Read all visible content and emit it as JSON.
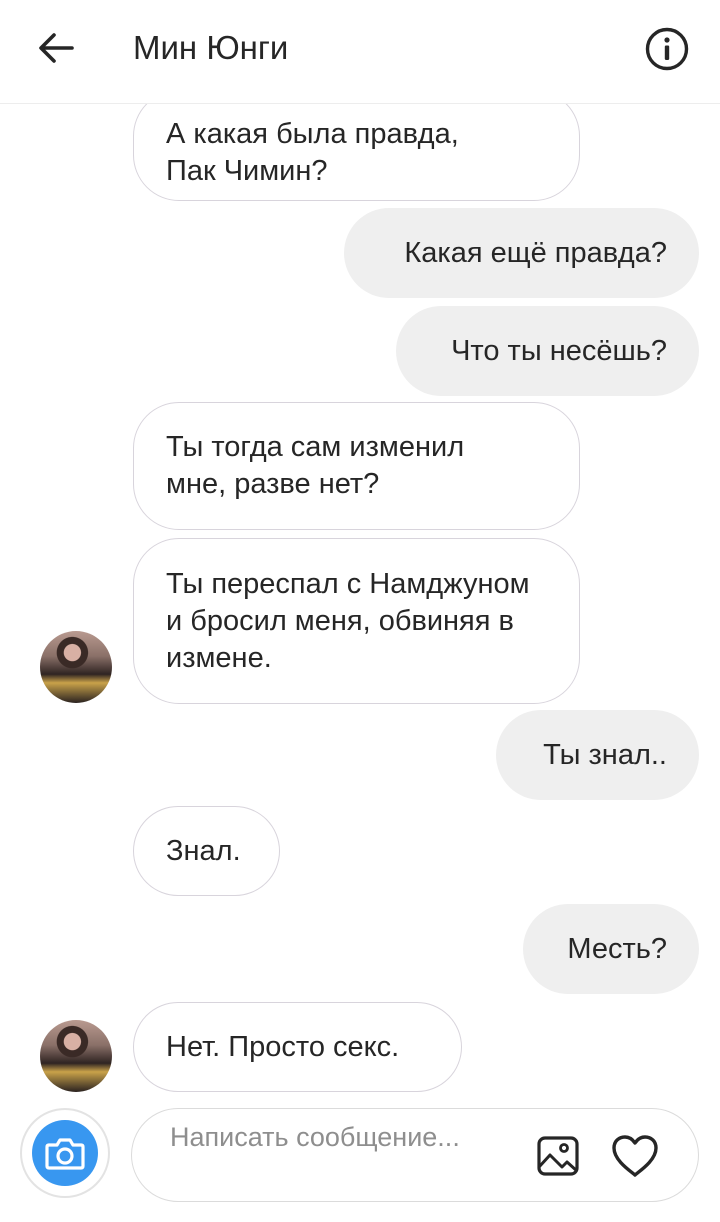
{
  "header": {
    "title": "Мин Юнги",
    "back_icon": "arrow-left-icon",
    "info_icon": "info-circle-icon"
  },
  "messages": [
    {
      "direction": "incoming",
      "text": "А какая была правда, Пак Чимин?"
    },
    {
      "direction": "outgoing",
      "text": "Какая ещё правда?"
    },
    {
      "direction": "outgoing",
      "text": "Что ты несёшь?"
    },
    {
      "direction": "incoming",
      "text": "Ты тогда сам изменил мне, разве нет?"
    },
    {
      "direction": "incoming",
      "text": "Ты переспал с Намджуном и бросил меня, обвиняя в измене."
    },
    {
      "direction": "outgoing",
      "text": "Ты знал.."
    },
    {
      "direction": "incoming",
      "text": "Знал."
    },
    {
      "direction": "outgoing",
      "text": "Месть?"
    },
    {
      "direction": "incoming",
      "text": "Нет. Просто секс."
    }
  ],
  "composer": {
    "placeholder": "Написать сообщение...",
    "camera_icon": "camera-icon",
    "gallery_icon": "image-gallery-icon",
    "heart_icon": "heart-icon"
  },
  "colors": {
    "accent": "#3897f0",
    "outgoing_bubble": "#efefef",
    "incoming_border": "#d8d4dc",
    "text": "#262626",
    "placeholder": "#8e8e8e"
  }
}
